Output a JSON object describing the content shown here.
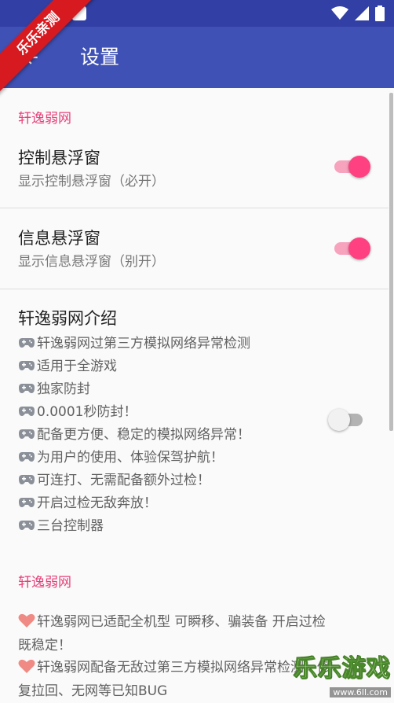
{
  "window": {
    "title": "设置",
    "back_icon": "arrow-left-icon"
  },
  "ribbon": {
    "text": "乐乐亲测"
  },
  "colors": {
    "appbar": "#3f51b5",
    "statusbar": "#3240a5",
    "accent": "#ff4081",
    "section": "#e5407a"
  },
  "sections": [
    {
      "header": "轩逸弱网"
    },
    {
      "header": "轩逸弱网"
    }
  ],
  "prefs": [
    {
      "title": "控制悬浮窗",
      "summary": "显示控制悬浮窗（必开）",
      "checked": true
    },
    {
      "title": "信息悬浮窗",
      "summary": "显示信息悬浮窗（别开）",
      "checked": true
    },
    {
      "title": "轩逸弱网介绍",
      "checked": false
    }
  ],
  "intro_lines": [
    "轩逸弱网过第三方模拟网络异常检测",
    "适用于全游戏",
    "独家防封",
    "0.0001秒防封！",
    "配备更方便、稳定的模拟网络异常！",
    "为用户的使用、体验保驾护航！",
    "可连打、无需配备额外过检！",
    "开启过检无敌奔放！",
    "三台控制器"
  ],
  "notes": [
    {
      "line1": "轩逸弱网已适配全机型 可瞬移、骗装备 开启过检",
      "line2": "既稳定！"
    },
    {
      "line1": "轩逸弱网配备无敌过第三方模拟网络异常检测，修",
      "line2": "复拉回、无网等已知BUG"
    }
  ],
  "watermark": {
    "brand": "乐乐游戏",
    "url": "www.6ll.com"
  }
}
